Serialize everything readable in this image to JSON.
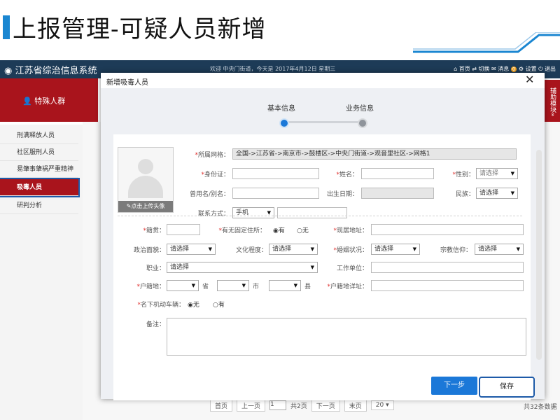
{
  "slide": {
    "title": "上报管理-可疑人员新增"
  },
  "app": {
    "name": "江苏省综治信息系统",
    "welcome": "欢迎 中央门街道，今天是 2017年4月12日 星期三",
    "nav": [
      "首页",
      "切换",
      "消息",
      "设置",
      "退出"
    ],
    "notify_count": "0"
  },
  "left_panel": {
    "title": "特殊人群"
  },
  "assist_panel": {
    "label": "辅助模块»"
  },
  "sidebar": {
    "items": [
      {
        "label": "刑满释放人员"
      },
      {
        "label": "社区服刑人员"
      },
      {
        "label": "易肇事肇祸严重精神障"
      },
      {
        "label": "吸毒人员"
      },
      {
        "label": "研判分析"
      }
    ]
  },
  "pager": {
    "first": "首页",
    "prev": "上一页",
    "current": "1",
    "total_pages": "共2页",
    "next": "下一页",
    "last": "末页",
    "page_size": "20",
    "total_count": "共32条数据"
  },
  "modal": {
    "title": "新增吸毒人员",
    "close": "✕",
    "steps": [
      {
        "label": "基本信息"
      },
      {
        "label": "业务信息"
      }
    ],
    "photo_upload": "点击上传头像",
    "fields": {
      "grid": {
        "label": "所属网格：",
        "value": "全国->江苏省->南京市->鼓楼区->中央门街道->观音里社区->网格1"
      },
      "id_card": {
        "label": "身份证："
      },
      "name": {
        "label": "姓名："
      },
      "gender": {
        "label": "性别：",
        "value": "请选择"
      },
      "alias": {
        "label": "曾用名/别名："
      },
      "birth": {
        "label": "出生日期："
      },
      "ethnicity": {
        "label": "民族：",
        "value": "请选择"
      },
      "contact": {
        "label": "联系方式：",
        "type": "手机"
      },
      "origin": {
        "label": "籍贯："
      },
      "fixed_residence": {
        "label": "有无固定住所：",
        "yes": "有",
        "no": "无"
      },
      "current_addr": {
        "label": "现居地址："
      },
      "political": {
        "label": "政治面貌：",
        "value": "请选择"
      },
      "education": {
        "label": "文化程度：",
        "value": "请选择"
      },
      "marital": {
        "label": "婚姻状况：",
        "value": "请选择"
      },
      "religion": {
        "label": "宗教信仰：",
        "value": "请选择"
      },
      "occupation": {
        "label": "职业：",
        "value": "请选择"
      },
      "workplace": {
        "label": "工作单位："
      },
      "household": {
        "label": "户籍地：",
        "province": "省",
        "city": "市",
        "county": "县"
      },
      "household_detail": {
        "label": "户籍地详址："
      },
      "vehicle": {
        "label": "名下机动车辆：",
        "no": "无",
        "yes": "有"
      },
      "remark": {
        "label": "备注："
      }
    },
    "buttons": {
      "next": "下一步",
      "save": "保存"
    }
  },
  "colors": {
    "brand_red": "#a9141c",
    "primary_blue": "#1b78d8",
    "header_navy": "#1d3b57"
  }
}
